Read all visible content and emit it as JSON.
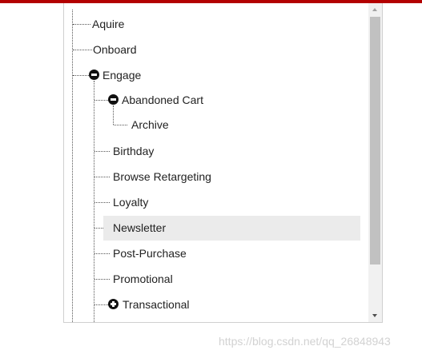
{
  "tree": {
    "nodes": [
      {
        "label": "Aquire"
      },
      {
        "label": "Onboard"
      },
      {
        "label": "Engage",
        "toggle": "collapse"
      },
      {
        "label": "Abandoned Cart",
        "toggle": "collapse"
      },
      {
        "label": "Archive"
      },
      {
        "label": "Birthday"
      },
      {
        "label": "Browse Retargeting"
      },
      {
        "label": "Loyalty"
      },
      {
        "label": "Newsletter",
        "selected": true
      },
      {
        "label": "Post-Purchase"
      },
      {
        "label": "Promotional"
      },
      {
        "label": "Transactional",
        "toggle": "expand"
      }
    ]
  },
  "scrollbar": {
    "icons": {
      "up": "triangle-up-icon",
      "down": "triangle-down-icon"
    }
  },
  "icons": {
    "collapse": "minus-circle-icon",
    "expand": "plus-circle-icon"
  },
  "colors": {
    "top_bar": "#b30000",
    "selected_background": "#ebebeb",
    "scroll_thumb": "#c1c1c1"
  },
  "watermark": {
    "text": "https://blog.csdn.net/qq_26848943"
  }
}
